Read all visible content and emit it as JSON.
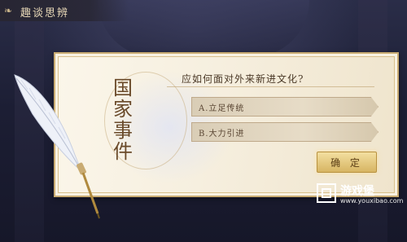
{
  "header": {
    "title": "趣谈思辨",
    "icon": "ornament-icon"
  },
  "card": {
    "event_title": "国家事件",
    "question": "应如何面对外来新进文化?",
    "options": [
      {
        "label": "A.立足传统"
      },
      {
        "label": "B.大力引进"
      }
    ],
    "confirm_label": "确 定"
  },
  "watermark": {
    "brand": "游戏堡",
    "url": "www.youxibao.com"
  },
  "colors": {
    "accent": "#d7b563",
    "card_bg": "#f6efdf",
    "text": "#4a3826"
  }
}
